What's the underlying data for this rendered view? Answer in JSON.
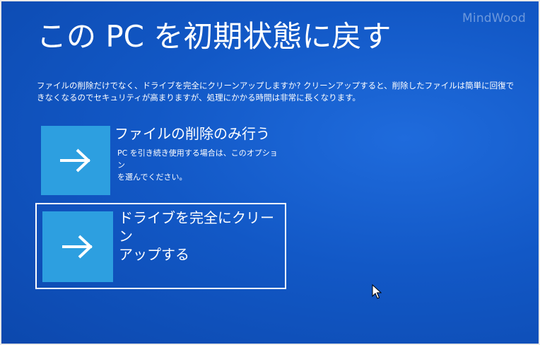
{
  "watermark": "MindWood",
  "title": "この PC を初期状態に戻す",
  "description": "ファイルの削除だけでなく、ドライブを完全にクリーンアップしますか? クリーンアップすると、削除したファイルは簡単に回復できなくなるのでセキュリティが高まりますが、処理にかかる時間は非常に長くなります。",
  "options": [
    {
      "title": "ファイルの削除のみ行う",
      "description": "PC を引き続き使用する場合は、このオプション\nを選んでください。",
      "icon": "arrow-right-icon",
      "focused": false
    },
    {
      "title": "ドライブを完全にクリーン\nアップする",
      "description": "",
      "icon": "arrow-right-icon",
      "focused": true
    }
  ],
  "colors": {
    "background": "#1258c6",
    "tile": "#2d9fe0",
    "text": "#ffffff",
    "focus_border": "#ffffff"
  }
}
